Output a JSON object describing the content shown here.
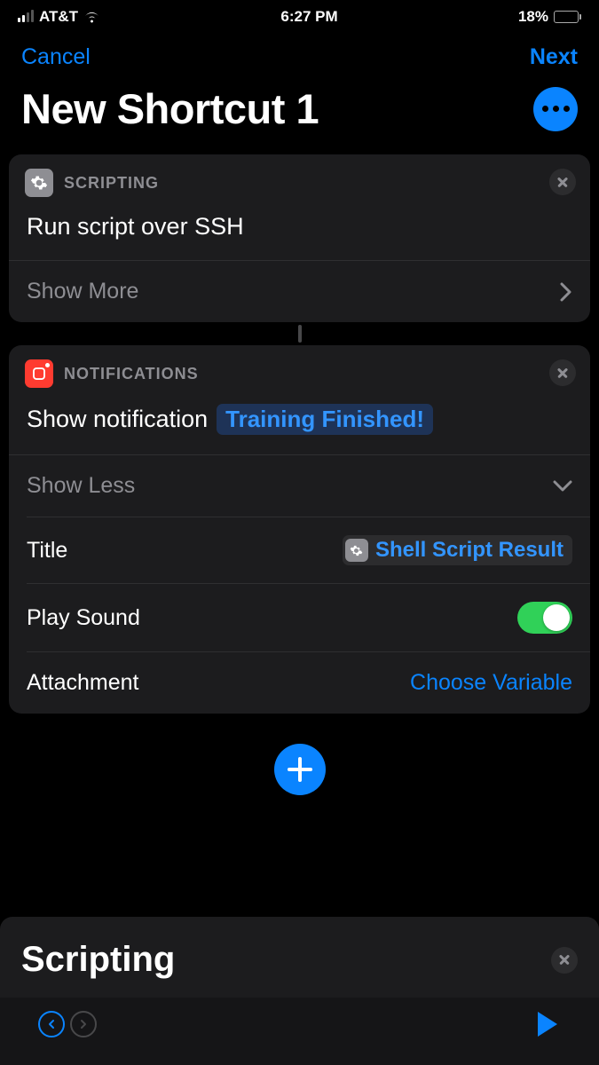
{
  "status": {
    "carrier": "AT&T",
    "time": "6:27 PM",
    "battery_pct": "18%"
  },
  "nav": {
    "cancel": "Cancel",
    "next": "Next"
  },
  "title": "New Shortcut 1",
  "actions": [
    {
      "category": "SCRIPTING",
      "icon": "gear",
      "icon_color": "gray",
      "title": "Run script over SSH",
      "expand_label": "Show More"
    },
    {
      "category": "NOTIFICATIONS",
      "icon": "notification",
      "icon_color": "red",
      "title": "Show notification",
      "param": "Training Finished!",
      "expand_label": "Show Less",
      "fields": {
        "title_label": "Title",
        "title_value": "Shell Script Result",
        "play_sound_label": "Play Sound",
        "play_sound": true,
        "attachment_label": "Attachment",
        "attachment_placeholder": "Choose Variable"
      }
    }
  ],
  "sheet": {
    "title": "Scripting"
  }
}
